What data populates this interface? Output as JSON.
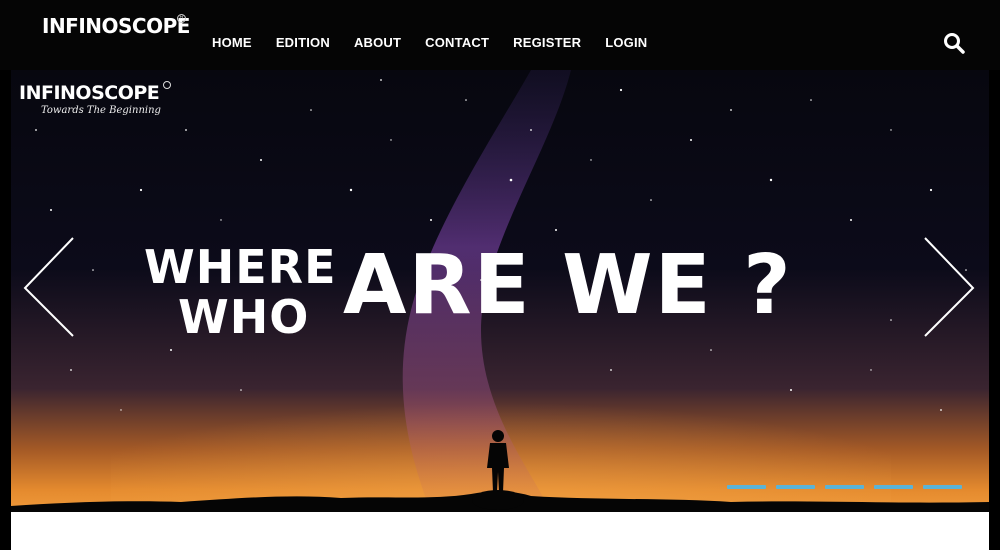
{
  "header": {
    "brand": "INFINOSCOPE",
    "nav": [
      {
        "label": "HOME"
      },
      {
        "label": "EDITION"
      },
      {
        "label": "ABOUT"
      },
      {
        "label": "CONTACT"
      },
      {
        "label": "REGISTER"
      },
      {
        "label": "LOGIN"
      }
    ],
    "search_icon": "search-icon"
  },
  "hero": {
    "logo": "INFINOSCOPE",
    "tagline": "Towards The Beginning",
    "headline_line1": "WHERE",
    "headline_line2": "WHO",
    "headline_main": "ARE WE ?",
    "prev_icon": "chevron-left-icon",
    "next_icon": "chevron-right-icon",
    "slide_count": 5,
    "indicator_color": "#5bb3d6"
  }
}
